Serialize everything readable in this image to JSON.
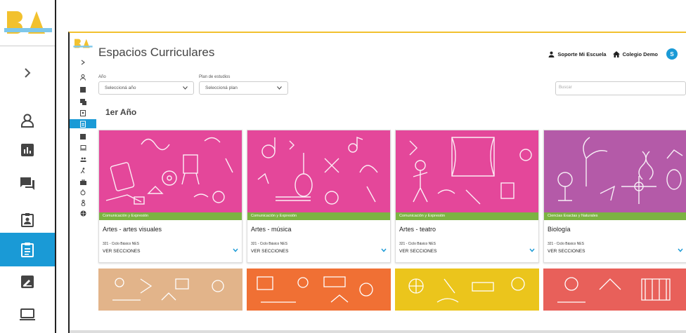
{
  "app": {
    "title": "Espacios Curriculares",
    "support_label": "Soporte Mi Escuela",
    "school_label": "Colegio Demo",
    "avatar_letter": "S"
  },
  "filters": {
    "year_label": "Año",
    "year_value": "Seleccioná año",
    "plan_label": "Plan de estudios",
    "plan_value": "Seleccioná plan",
    "search_placeholder": "Buscar"
  },
  "section_title": "1er Año",
  "cards": [
    {
      "category": "Comunicación y Expresión",
      "name": "Artes - artes visuales",
      "subtitle": "321 - Ciclo Básico NES",
      "action": "VER SECCIONES",
      "color": "#e4479a"
    },
    {
      "category": "Comunicación y Expresión",
      "name": "Artes - música",
      "subtitle": "321 - Ciclo Básico NES",
      "action": "VER SECCIONES",
      "color": "#e4479a"
    },
    {
      "category": "Comunicación y Expresión",
      "name": "Artes - teatro",
      "subtitle": "321 - Ciclo Básico NES",
      "action": "VER SECCIONES",
      "color": "#e4479a"
    },
    {
      "category": "Ciencias Exactas y Naturales",
      "name": "Biología",
      "subtitle": "321 - Ciclo Básico NES",
      "action": "VER SECCIONES",
      "color": "#b45aa8"
    }
  ],
  "second_row_colors": [
    "#e2b48a",
    "#f07034",
    "#ebc51c",
    "#e8605a"
  ],
  "colors": {
    "accent": "#1a9ad6",
    "category_bar": "#7cb342",
    "brand_yellow": "#f2c12e"
  }
}
